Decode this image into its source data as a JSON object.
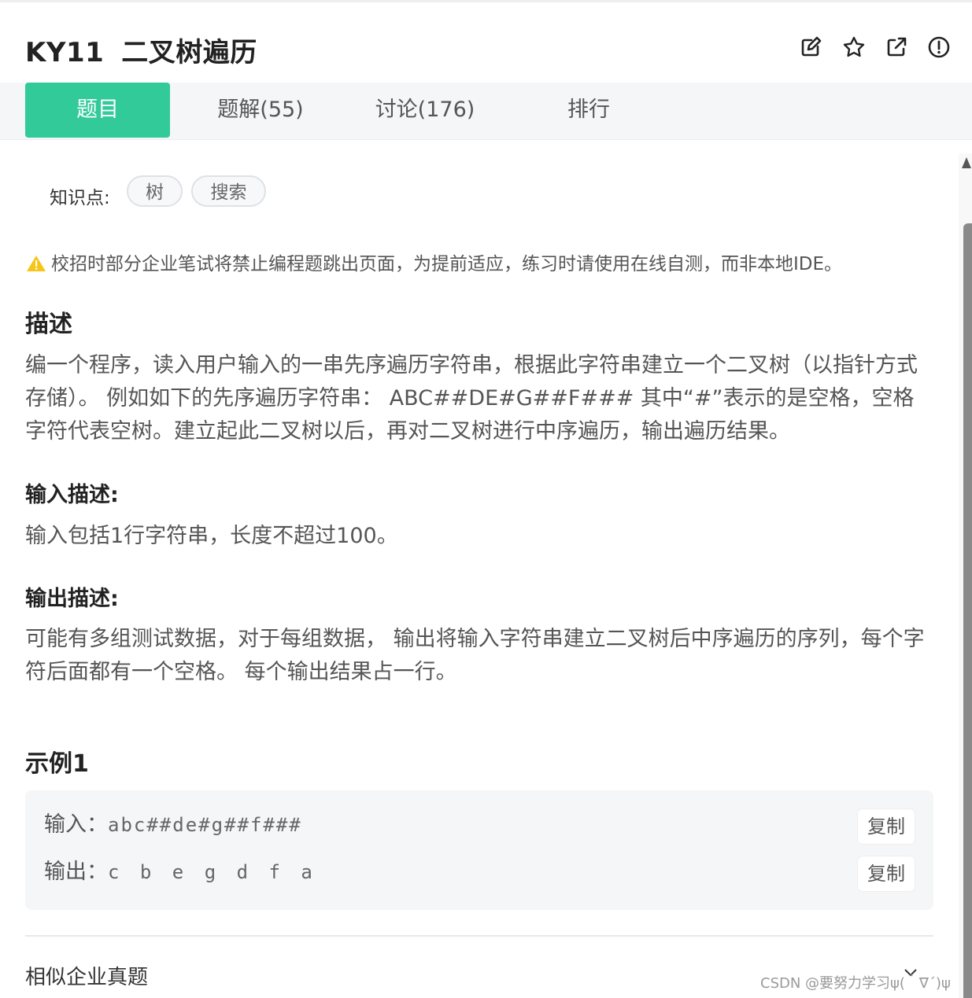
{
  "header": {
    "code": "KY11",
    "title": "二叉树遍历",
    "icons": [
      "edit-icon",
      "star-icon",
      "external-link-icon",
      "info-icon"
    ]
  },
  "tabs": [
    {
      "label": "题目",
      "active": true
    },
    {
      "label": "题解(55)",
      "active": false
    },
    {
      "label": "讨论(176)",
      "active": false
    },
    {
      "label": "排行",
      "active": false
    }
  ],
  "knowledge": {
    "label": "知识点:",
    "tags": [
      "树",
      "搜索"
    ]
  },
  "warning": "校招时部分企业笔试将禁止编程题跳出页面，为提前适应，练习时请使用在线自测，而非本地IDE。",
  "description": {
    "heading": "描述",
    "text": "编一个程序，读入用户输入的一串先序遍历字符串，根据此字符串建立一个二叉树（以指针方式存储）。 例如如下的先序遍历字符串： ABC##DE#G##F### 其中“#”表示的是空格，空格字符代表空树。建立起此二叉树以后，再对二叉树进行中序遍历，输出遍历结果。"
  },
  "input_desc": {
    "heading": "输入描述:",
    "text": "输入包括1行字符串，长度不超过100。"
  },
  "output_desc": {
    "heading": "输出描述:",
    "text": "可能有多组测试数据，对于每组数据， 输出将输入字符串建立二叉树后中序遍历的序列，每个字符后面都有一个空格。 每个输出结果占一行。"
  },
  "example": {
    "heading": "示例1",
    "input_label": "输入：",
    "input_value": "abc##de#g##f###",
    "output_label": "输出：",
    "output_value": "c b e g d f a",
    "copy_label": "复制"
  },
  "similar": "相似企业真题",
  "watermark": "CSDN @要努力学习ψ(｀∇´)ψ",
  "colors": {
    "accent": "#32ca99",
    "warning": "#f5c518",
    "tabbar_bg": "#f5f6f8"
  }
}
